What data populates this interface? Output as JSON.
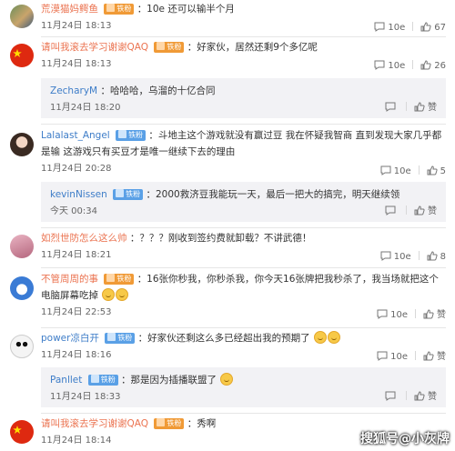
{
  "comments": [
    {
      "user": "荒漠猫妈鳄鱼",
      "user_color": "orange",
      "badge": "铁粉",
      "badge_color": "orange",
      "text": "：10e 还可以输半个月",
      "time": "11月24日 18:13",
      "reply_count": "10e",
      "likes": "67",
      "avatar": "photo"
    },
    {
      "user": "请叫我滚去学习谢谢QAQ",
      "user_color": "orange",
      "badge": "铁粉",
      "badge_color": "orange",
      "text": "：好家伙，居然还剩9个多亿呢",
      "time": "11月24日 18:13",
      "reply_count": "10e",
      "likes": "26",
      "avatar": "flag",
      "reply": {
        "user": "ZecharyM",
        "text": "：哈哈哈，乌溜的十亿合同",
        "time": "11月24日 18:20",
        "likes": "赞"
      }
    },
    {
      "user": "Lalalast_Angel",
      "user_color": "blue",
      "badge": "铁粉",
      "badge_color": "blue",
      "text": "：斗地主这个游戏就没有赢过豆 我在怀疑我智商 直到发现大家几乎都是输 这游戏只有买豆才是唯一继续下去的理由",
      "time": "11月24日 20:28",
      "reply_count": "10e",
      "likes": "5",
      "avatar": "girl",
      "reply": {
        "user": "kevinNissen",
        "badge": "铁粉",
        "text": "：2000救济豆我能玩一天，最后一把大的搞完，明天继续领",
        "time": "今天 00:34",
        "likes": "赞"
      }
    },
    {
      "user": "如烈世防怎么这么帅",
      "user_color": "orange",
      "text": "：？？？刚收到签约费就卸载？不讲武德！",
      "time": "11月24日 18:21",
      "reply_count": "10e",
      "likes": "8",
      "avatar": "pink"
    },
    {
      "user": "不管周周的事",
      "user_color": "orange",
      "badge": "铁粉",
      "badge_color": "orange",
      "text": "：16张你秒我，你秒杀我，你今天16张牌把我秒杀了，我当场就把这个电脑屏幕吃掉",
      "time": "11月24日 22:53",
      "reply_count": "10e",
      "likes": "赞",
      "avatar": "cartoon"
    },
    {
      "user": "power凉白开",
      "user_color": "blue",
      "badge": "铁粉",
      "badge_color": "blue",
      "text": "：好家伙还剩这么多已经超出我的预期了",
      "time": "11月24日 18:16",
      "reply_count": "10e",
      "likes": "赞",
      "avatar": "panda",
      "reply": {
        "user": "Panllet",
        "badge": "铁粉",
        "text": "：那是因为插播联盟了",
        "time": "11月24日 18:33",
        "likes": "赞"
      }
    },
    {
      "user": "请叫我滚去学习谢谢QAQ",
      "user_color": "orange",
      "badge": "铁粉",
      "badge_color": "orange",
      "text": "：秀啊",
      "time": "11月24日 18:14",
      "reply_count": "10e",
      "likes": "赞",
      "avatar": "flag"
    }
  ],
  "watermark": "搜狐号@小灰牌",
  "icons": {
    "reply": "reply-icon",
    "like": "thumbs-up-icon"
  }
}
